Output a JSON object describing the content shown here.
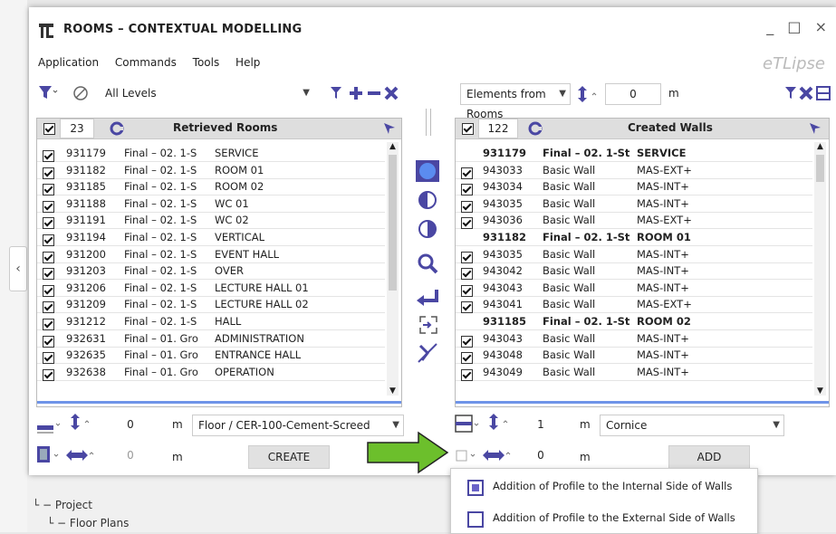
{
  "window": {
    "title": "ROOMS – CONTEXTUAL MODELLING",
    "brand": "eTLipse",
    "min": "_",
    "max": "□",
    "close": "×"
  },
  "menu": [
    "Application",
    "Commands",
    "Tools",
    "Help"
  ],
  "left": {
    "levels_value": "All Levels",
    "count": "23",
    "header_title": "Retrieved Rooms",
    "rows": [
      [
        "931179",
        "Final – 02. 1-S",
        "SERVICE"
      ],
      [
        "931182",
        "Final – 02. 1-S",
        "ROOM 01"
      ],
      [
        "931185",
        "Final – 02. 1-S",
        "ROOM 02"
      ],
      [
        "931188",
        "Final – 02. 1-S",
        "WC 01"
      ],
      [
        "931191",
        "Final – 02. 1-S",
        "WC 02"
      ],
      [
        "931194",
        "Final – 02. 1-S",
        "VERTICAL"
      ],
      [
        "931200",
        "Final – 02. 1-S",
        "EVENT HALL"
      ],
      [
        "931203",
        "Final – 02. 1-S",
        "OVER"
      ],
      [
        "931206",
        "Final – 02. 1-S",
        "LECTURE HALL 01"
      ],
      [
        "931209",
        "Final – 02. 1-S",
        "LECTURE HALL 02"
      ],
      [
        "931212",
        "Final – 02. 1-S",
        "HALL"
      ],
      [
        "932631",
        "Final – 01. Gro",
        "ADMINISTRATION"
      ],
      [
        "932635",
        "Final – 01. Gro",
        "ENTRANCE HALL"
      ],
      [
        "932638",
        "Final – 01. Gro",
        "OPERATION"
      ]
    ],
    "offset_value": "0",
    "offset_unit": "m",
    "floor_type": "Floor / CER-100-Cement-Screed",
    "width_value": "0",
    "width_unit": "m",
    "create_label": "CREATE"
  },
  "right": {
    "source_value": "Elements from Rooms",
    "offset_value": "0",
    "offset_unit": "m",
    "count": "122",
    "header_title": "Created Walls",
    "rows": [
      {
        "h": true,
        "cells": [
          "931179",
          "Final – 02. 1-St",
          "SERVICE"
        ]
      },
      {
        "h": false,
        "cells": [
          "943033",
          "Basic Wall",
          "MAS-EXT+"
        ]
      },
      {
        "h": false,
        "cells": [
          "943034",
          "Basic Wall",
          "MAS-INT+"
        ]
      },
      {
        "h": false,
        "cells": [
          "943035",
          "Basic Wall",
          "MAS-INT+"
        ]
      },
      {
        "h": false,
        "cells": [
          "943036",
          "Basic Wall",
          "MAS-EXT+"
        ]
      },
      {
        "h": true,
        "cells": [
          "931182",
          "Final – 02. 1-St",
          "ROOM 01"
        ]
      },
      {
        "h": false,
        "cells": [
          "943035",
          "Basic Wall",
          "MAS-INT+"
        ]
      },
      {
        "h": false,
        "cells": [
          "943042",
          "Basic Wall",
          "MAS-INT+"
        ]
      },
      {
        "h": false,
        "cells": [
          "943043",
          "Basic Wall",
          "MAS-INT+"
        ]
      },
      {
        "h": false,
        "cells": [
          "943041",
          "Basic Wall",
          "MAS-EXT+"
        ]
      },
      {
        "h": true,
        "cells": [
          "931185",
          "Final – 02. 1-St",
          "ROOM 02"
        ]
      },
      {
        "h": false,
        "cells": [
          "943043",
          "Basic Wall",
          "MAS-INT+"
        ]
      },
      {
        "h": false,
        "cells": [
          "943048",
          "Basic Wall",
          "MAS-INT+"
        ]
      },
      {
        "h": false,
        "cells": [
          "943049",
          "Basic Wall",
          "MAS-INT+"
        ]
      }
    ],
    "height_value": "1",
    "height_unit": "m",
    "profile_type": "Cornice",
    "width_value": "0",
    "width_unit": "m",
    "add_label": "ADD"
  },
  "popup": {
    "items": [
      "Addition of Profile to the Internal Side of Walls",
      "Addition of Profile to the External Side of Walls"
    ]
  },
  "tree": {
    "project": "Project",
    "floor_plans": "Floor Plans"
  },
  "colors": {
    "accent": "#5b8cf0",
    "purple": "#4a47a3",
    "green": "#6cbf2c"
  }
}
